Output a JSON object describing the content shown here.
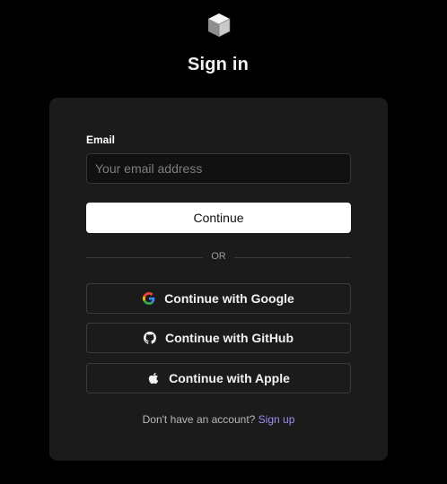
{
  "header": {
    "logo_icon": "cube-logo-icon",
    "title": "Sign in"
  },
  "form": {
    "email_label": "Email",
    "email_placeholder": "Your email address",
    "email_value": "",
    "continue_label": "Continue",
    "divider_text": "OR"
  },
  "social": {
    "google": {
      "label": "Continue with Google",
      "icon": "google-icon"
    },
    "github": {
      "label": "Continue with GitHub",
      "icon": "github-icon"
    },
    "apple": {
      "label": "Continue with Apple",
      "icon": "apple-icon"
    }
  },
  "footer": {
    "prompt": "Don't have an account?",
    "signup_link": "Sign up"
  },
  "colors": {
    "background": "#000000",
    "card": "#1b1b1c",
    "link": "#9f8fee",
    "primary_button": "#ffffff"
  }
}
